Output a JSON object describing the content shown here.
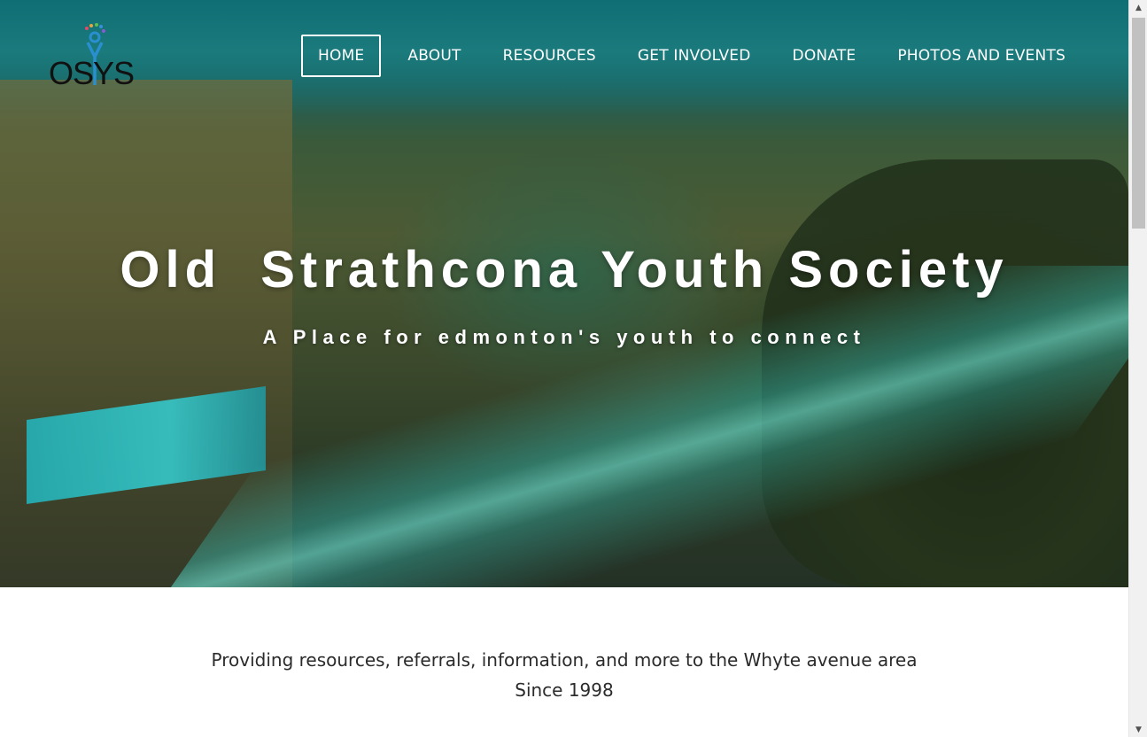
{
  "logo": {
    "text": "OSYS"
  },
  "nav": {
    "items": [
      {
        "label": "HOME",
        "active": true
      },
      {
        "label": "ABOUT"
      },
      {
        "label": "RESOURCES"
      },
      {
        "label": "GET INVOLVED"
      },
      {
        "label": "DONATE"
      },
      {
        "label": "PHOTOS AND EVENTS"
      }
    ]
  },
  "hero": {
    "title": "Old  Strathcona Youth Society",
    "subtitle": "A Place for edmonton's youth to connect"
  },
  "tagline": {
    "line1": "Providing resources, referrals, information, and more to the Whyte avenue area",
    "line2": "Since 1998"
  },
  "colors": {
    "accent": "#1a8f8f",
    "nav_text": "#ffffff",
    "body_text": "#2b2b2b"
  },
  "icons": {
    "scroll_up": "chevron-up-icon",
    "scroll_down": "chevron-down-icon"
  }
}
